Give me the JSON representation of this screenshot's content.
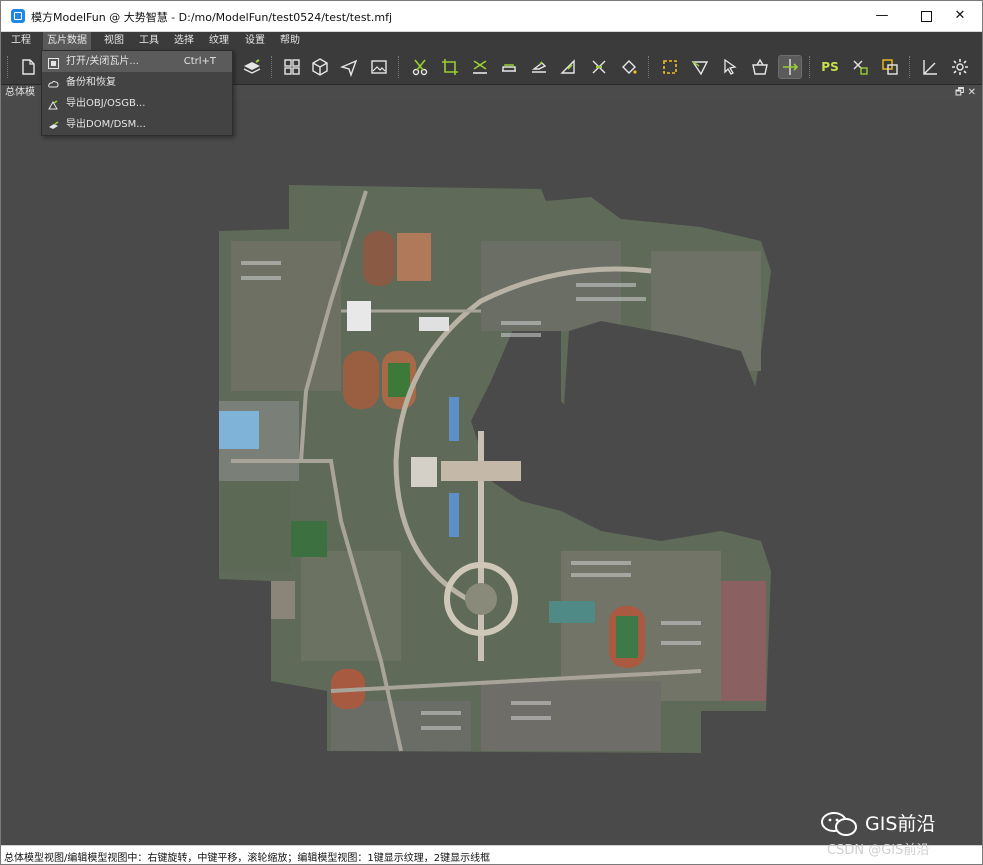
{
  "window": {
    "title": "模方ModelFun @ 大势智慧 - D:/mo/ModelFun/test0524/test/test.mfj",
    "minimize": "—",
    "close": "✕"
  },
  "menu": [
    "工程",
    "瓦片数据",
    "视图",
    "工具",
    "选择",
    "纹理",
    "设置",
    "帮助"
  ],
  "menu_active": "瓦片数据",
  "dropdown": {
    "items": [
      {
        "icon": "square-icon",
        "label": "打开/关闭瓦片...",
        "shortcut": "Ctrl+T"
      },
      {
        "icon": "cloud-icon",
        "label": "备份和恢复",
        "shortcut": ""
      },
      {
        "icon": "export-obj-icon",
        "label": "导出OBJ/OSGB...",
        "shortcut": ""
      },
      {
        "icon": "export-dom-icon",
        "label": "导出DOM/DSM...",
        "shortcut": ""
      }
    ]
  },
  "panel": {
    "tab": "总体模",
    "buttons": "🗗 ✕"
  },
  "toolbar": {
    "ps_label": "PS"
  },
  "statusbar": {
    "text": "总体模型视图/编辑模型视图中：右键旋转，中键平移，滚轮缩放；编辑模型视图：1键显示纹理，2键显示线框"
  },
  "watermark": {
    "logo_text": "GIS前沿",
    "credit": "CSDN @GIS前沿"
  },
  "colors": {
    "menu_bg": "#3b3b3b",
    "viewport_bg": "#4a4a4a",
    "icon_color": "#e6e6e6",
    "accent_green": "#9acd32",
    "accent_yellow": "#f0c020",
    "accent_red": "#e04040"
  }
}
